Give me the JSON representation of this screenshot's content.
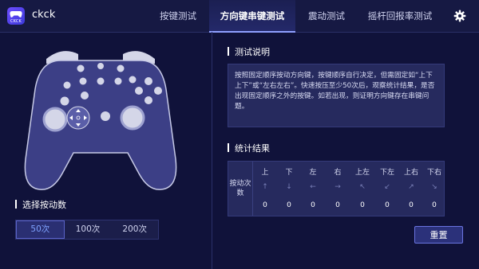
{
  "app": {
    "name": "ckck",
    "logo_text": "CKCK"
  },
  "tabs": [
    {
      "label": "按键测试",
      "active": false
    },
    {
      "label": "方向键串键测试",
      "active": true
    },
    {
      "label": "震动测试",
      "active": false
    },
    {
      "label": "摇杆回报率测试",
      "active": false
    }
  ],
  "header": {
    "settings_icon": "gear-icon"
  },
  "left": {
    "select_title": "选择按动数",
    "count_options": [
      "50次",
      "100次",
      "200次"
    ],
    "selected_count": "50次"
  },
  "right": {
    "desc_title": "测试说明",
    "description": "按照固定顺序按动方向键，按键顺序自行决定，但需固定如“上下上下”或“左右左右”。快速按压至少50次后，观察统计结果，是否出现固定顺序之外的按键。如若出现，则证明方向键存在串键问题。",
    "stats_title": "统计结果",
    "row_label": "按动次数",
    "columns": [
      {
        "label": "上",
        "arrow": "↑",
        "value": "0"
      },
      {
        "label": "下",
        "arrow": "↓",
        "value": "0"
      },
      {
        "label": "左",
        "arrow": "←",
        "value": "0"
      },
      {
        "label": "右",
        "arrow": "→",
        "value": "0"
      },
      {
        "label": "上左",
        "arrow": "↖",
        "value": "0"
      },
      {
        "label": "下左",
        "arrow": "↙",
        "value": "0"
      },
      {
        "label": "上右",
        "arrow": "↗",
        "value": "0"
      },
      {
        "label": "下右",
        "arrow": "↘",
        "value": "0"
      }
    ],
    "reset_label": "重置"
  },
  "colors": {
    "accent": "#7fa2ff",
    "background": "#10123a",
    "panel": "#262a5e"
  }
}
